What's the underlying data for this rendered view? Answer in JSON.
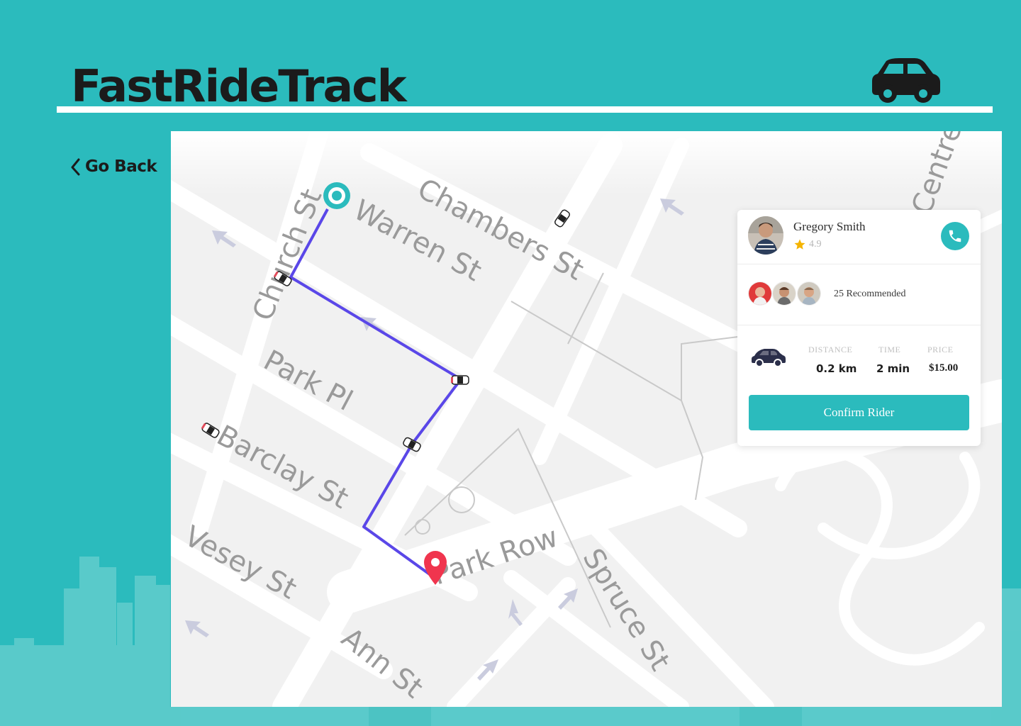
{
  "app": {
    "title": "FastRideTrack",
    "accent_color": "#2bbbbd",
    "logo_icon": "car-icon"
  },
  "nav": {
    "back_label": "Go Back",
    "back_icon": "chevron-left-icon"
  },
  "map": {
    "streets": [
      "Chambers St",
      "Warren St",
      "Church St",
      "Park Pl",
      "Barclay St",
      "Vesey St",
      "Park Row",
      "Spruce St",
      "Ann St",
      "Centre St"
    ],
    "route_color": "#5a47e8",
    "pickup_marker_icon": "pickup-marker-icon",
    "dropoff_marker_icon": "dropoff-pin-icon",
    "car_icon": "taxi-car-icon"
  },
  "card": {
    "driver": {
      "name": "Gregory Smith",
      "rating": "4.9",
      "rating_icon": "star-icon",
      "call_icon": "phone-icon"
    },
    "recommended": {
      "text": "25 Recommended"
    },
    "vehicle_icon": "car-icon",
    "stats": [
      {
        "label": "DISTANCE",
        "value": "0.2 km"
      },
      {
        "label": "TIME",
        "value": "2 min"
      },
      {
        "label": "PRICE",
        "value": "$15.00"
      }
    ],
    "confirm_label": "Confirm Rider"
  }
}
